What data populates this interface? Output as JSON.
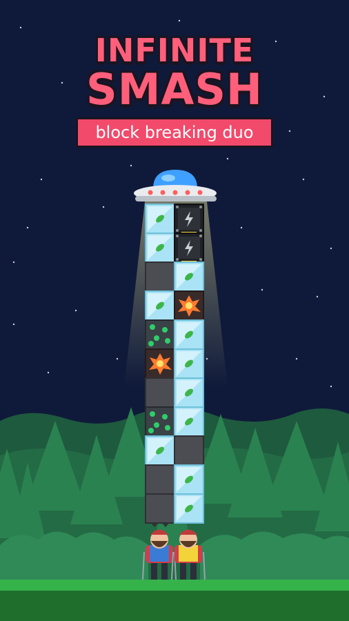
{
  "title": {
    "line1": "INFINITE",
    "line2": "SMASH",
    "subtitle": "block breaking duo"
  },
  "colors": {
    "sky": "#0f1a3a",
    "title": "#ff5f7a",
    "subtitle_bg": "#f24a6b",
    "ice": "#a9e3f5",
    "stone": "#4b4d52",
    "grass": "#2f9e3f",
    "forest_far": "#1e5a3e",
    "forest_near": "#2c7a4e"
  },
  "tower": {
    "columns": [
      [
        "ice",
        "ice",
        "stone",
        "ice",
        "slime",
        "lava",
        "stone",
        "slime",
        "ice",
        "stone",
        "stone"
      ],
      [
        "bomb",
        "bomb",
        "ice",
        "lava",
        "ice",
        "ice",
        "ice",
        "ice",
        "stone",
        "ice",
        "ice"
      ]
    ]
  },
  "characters": [
    {
      "name": "blue-hiker",
      "shirt": "#3a7bd5"
    },
    {
      "name": "yellow-hiker",
      "shirt": "#f2d43a"
    }
  ]
}
